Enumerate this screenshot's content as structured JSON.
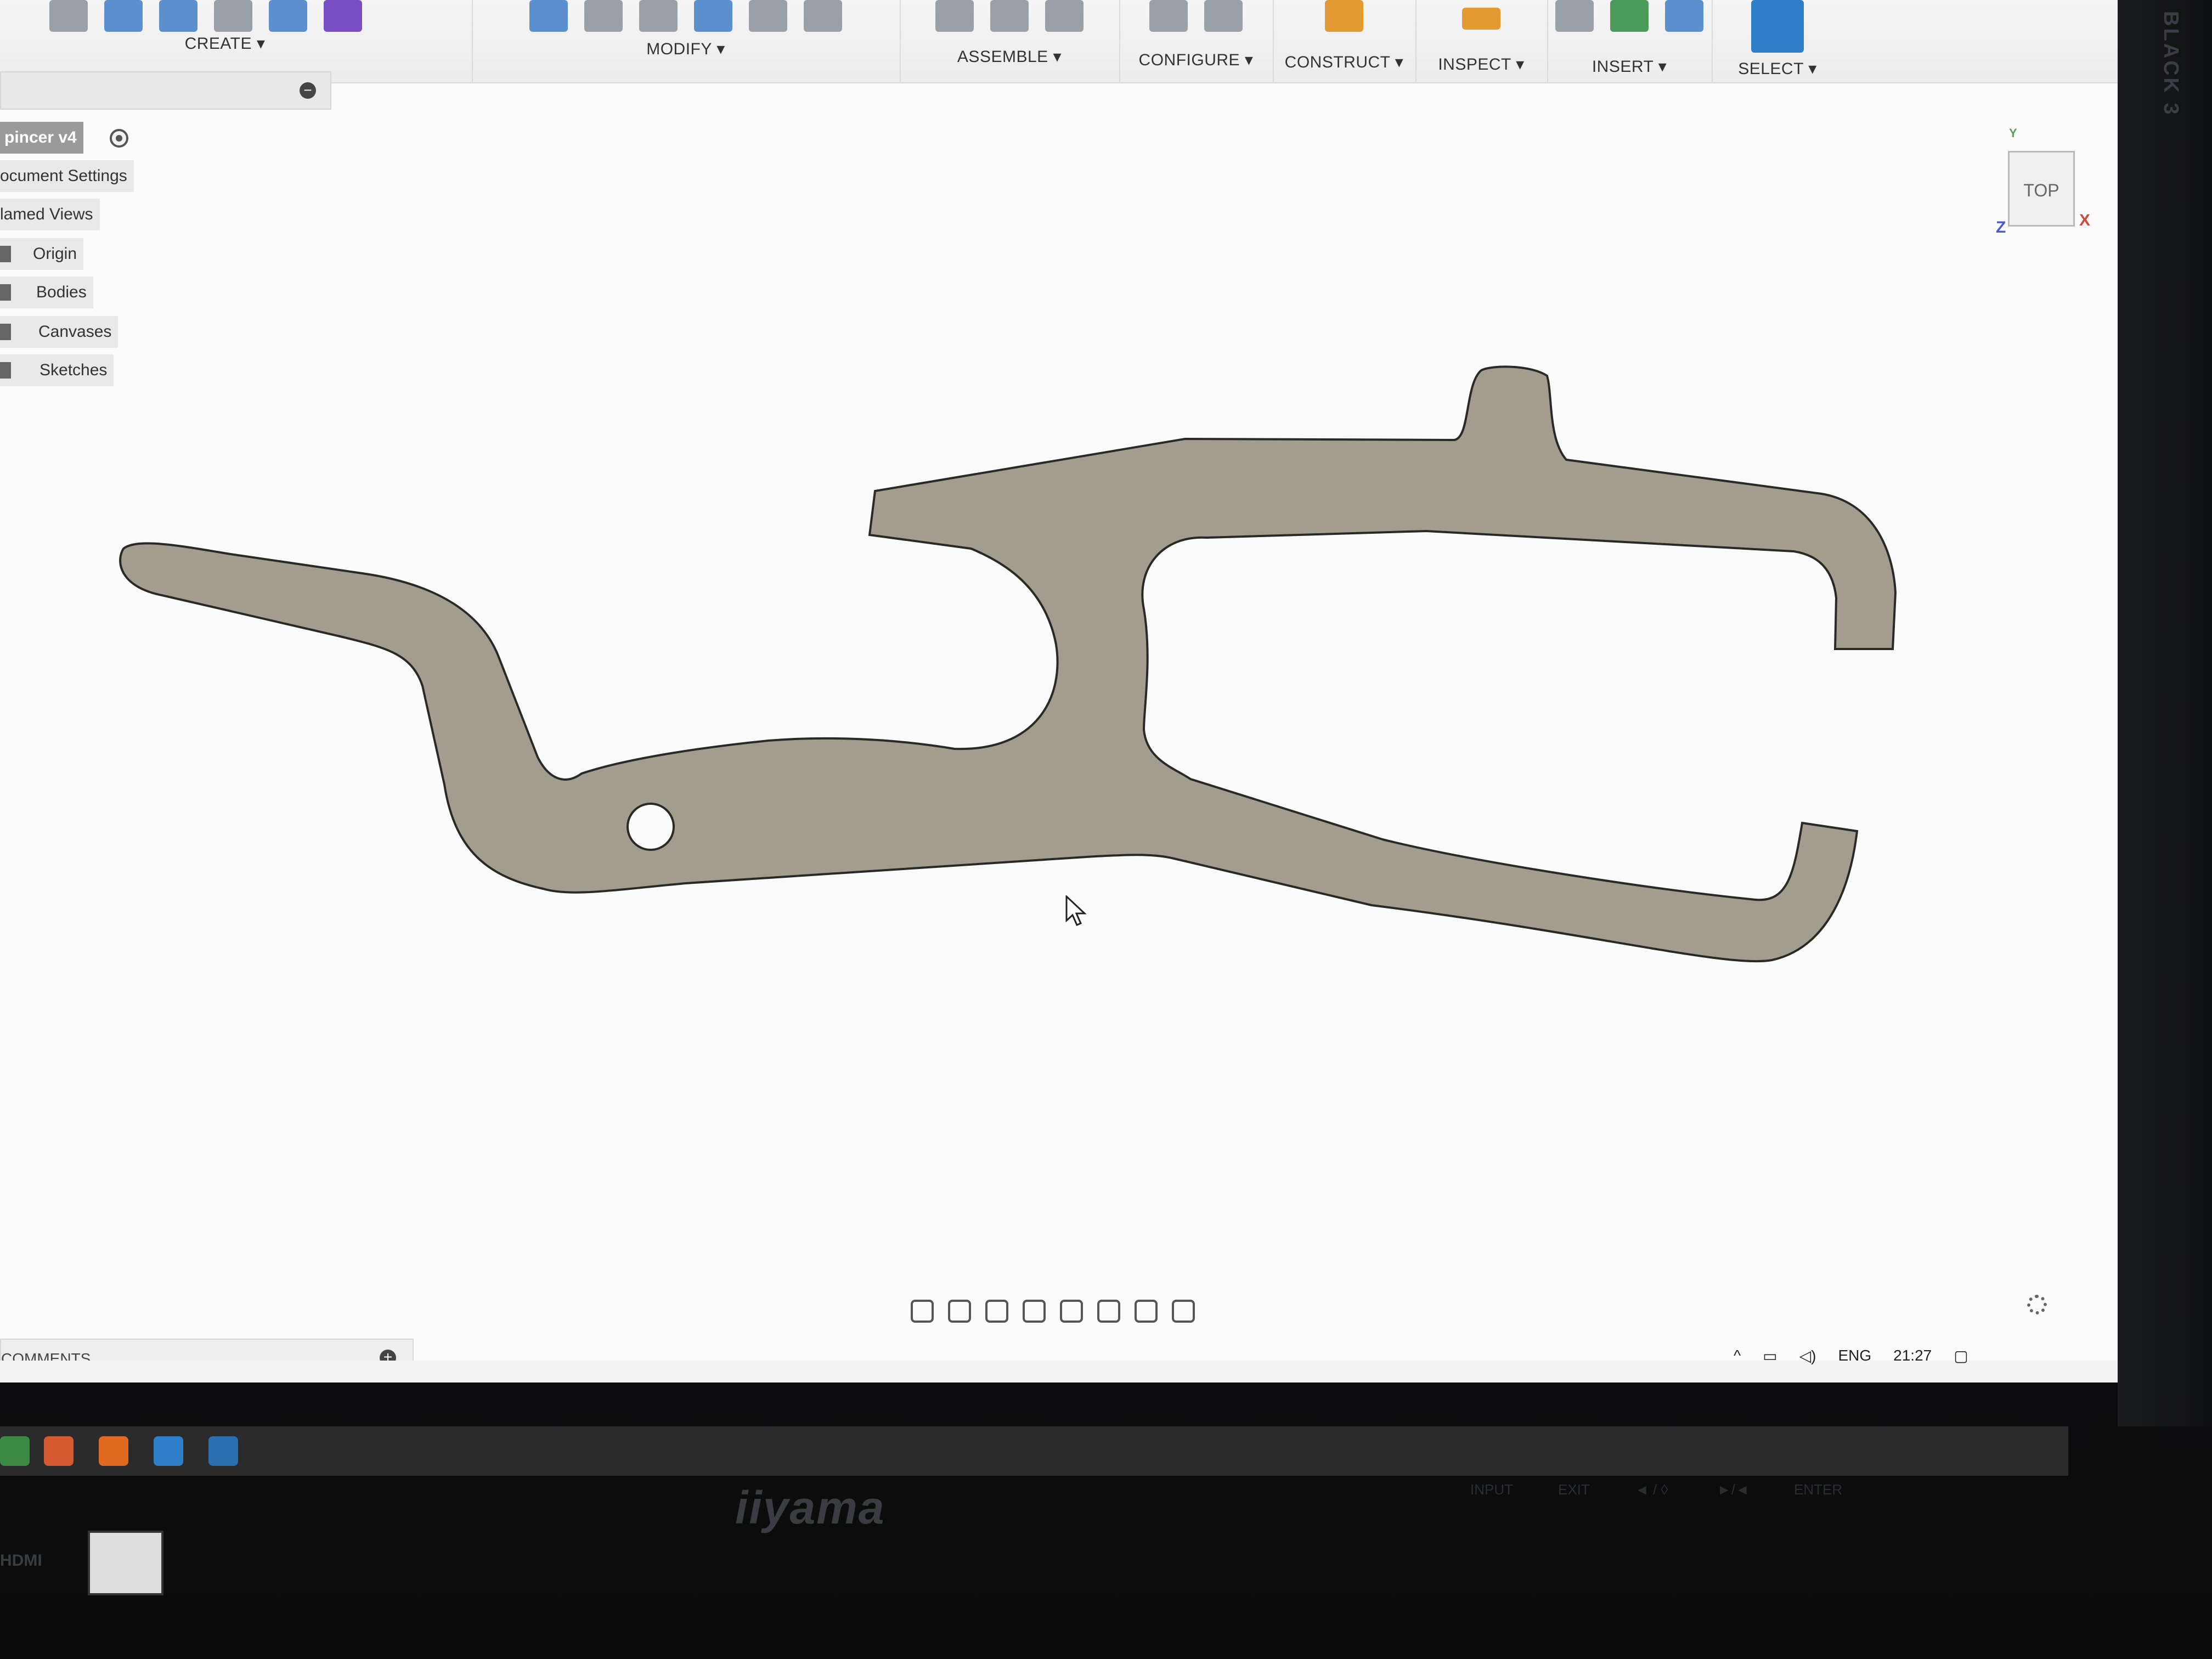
{
  "toolbar": {
    "groups": [
      {
        "label": "CREATE ▾"
      },
      {
        "label": "MODIFY ▾"
      },
      {
        "label": "ASSEMBLE ▾"
      },
      {
        "label": "CONFIGURE ▾"
      },
      {
        "label": "CONSTRUCT ▾"
      },
      {
        "label": "INSPECT ▾"
      },
      {
        "label": "INSERT ▾"
      },
      {
        "label": "SELECT ▾"
      }
    ]
  },
  "browser": {
    "root": "pincer v4",
    "items": [
      {
        "label": "ocument Settings"
      },
      {
        "label": "lamed Views"
      },
      {
        "label": "Origin"
      },
      {
        "label": "Bodies"
      },
      {
        "label": "Canvases"
      },
      {
        "label": "Sketches"
      }
    ]
  },
  "viewcube": {
    "face": "TOP",
    "axis_x": "X",
    "axis_z": "Z",
    "axis_y": "Y"
  },
  "comments": {
    "label": "COMMENTS"
  },
  "tray": {
    "lang": "ENG",
    "time": "21:27"
  },
  "monitor": {
    "brand": "iiyama",
    "port": "HDMI",
    "bezel_text": "BLACK 3",
    "buttons": [
      "INPUT",
      "EXIT",
      "◄ / ◊",
      "►/◄",
      "ENTER"
    ]
  },
  "colors": {
    "part_fill": "#a29d8f",
    "timeline_bar": "#d672c8",
    "accent": "#2f7fc8"
  }
}
